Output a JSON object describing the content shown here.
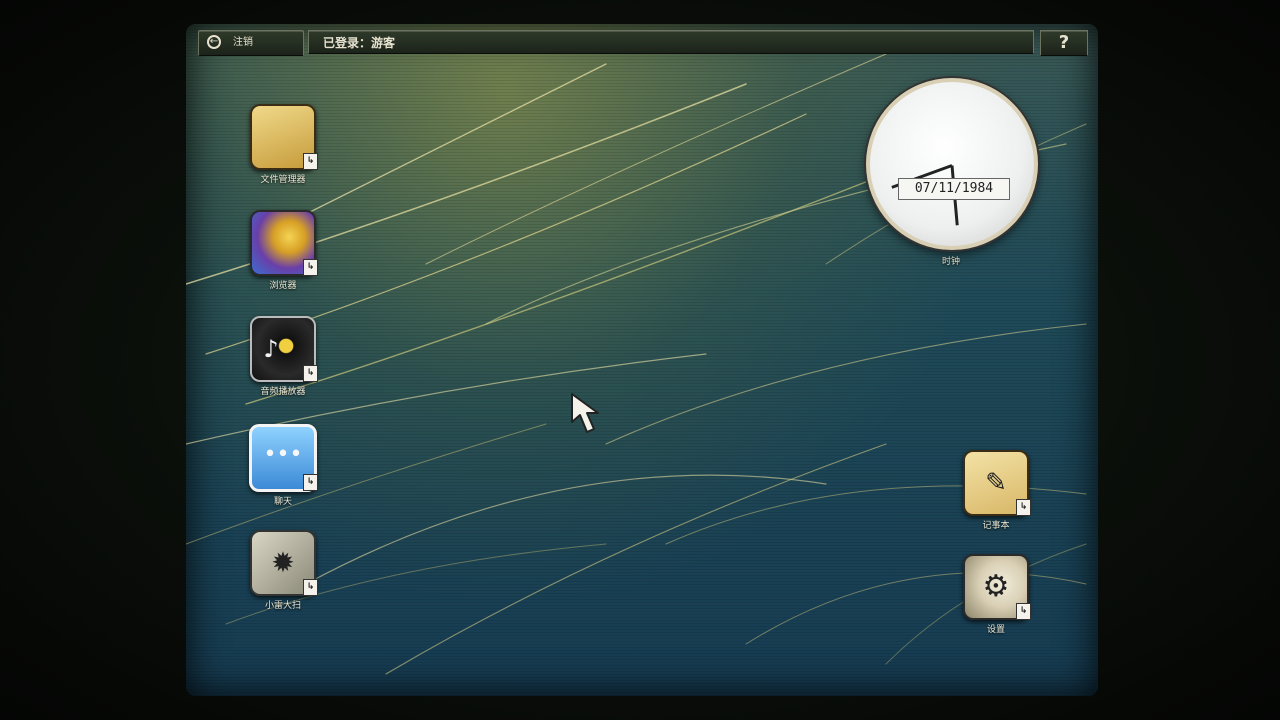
{
  "topbar": {
    "logout_label": "注销",
    "user_status": "已登录：游客",
    "help_label": "?"
  },
  "desktop_icons_left": [
    {
      "label": "文件管理器",
      "icon": "folder-icon"
    },
    {
      "label": "浏览器",
      "icon": "browser-icon"
    },
    {
      "label": "音频播放器",
      "icon": "music-player-icon"
    },
    {
      "label": "聊天",
      "icon": "chat-icon"
    },
    {
      "label": "小雷大扫",
      "icon": "minesweeper-icon"
    }
  ],
  "desktop_icons_right": [
    {
      "label": "记事本",
      "icon": "notepad-icon"
    },
    {
      "label": "设置",
      "icon": "settings-icon"
    }
  ],
  "clock": {
    "date": "07/11/1984",
    "label": "时钟"
  },
  "shortcut_glyph": "↳"
}
